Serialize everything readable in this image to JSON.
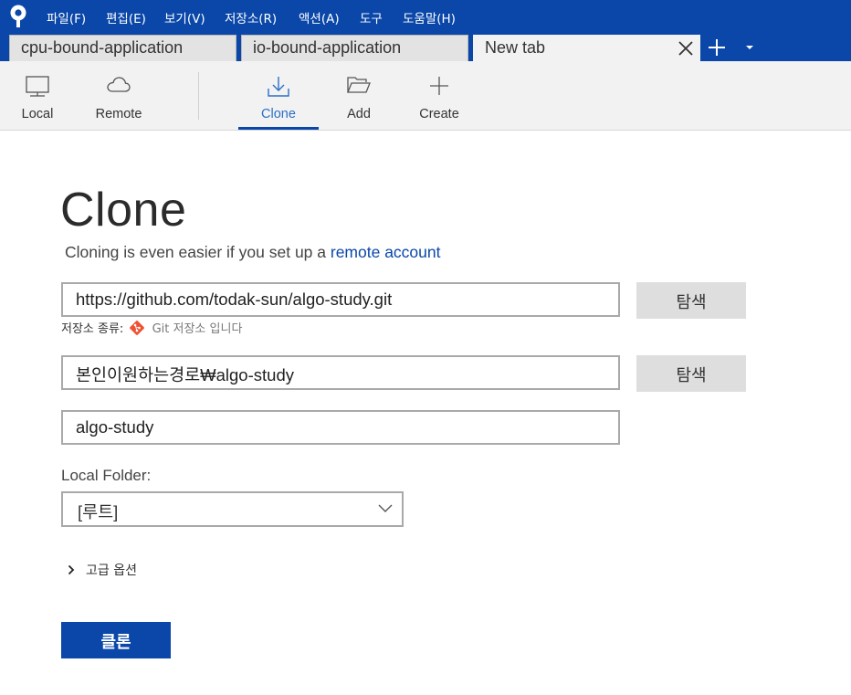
{
  "menu": [
    "파일(F)",
    "편집(E)",
    "보기(V)",
    "저장소(R)",
    "액션(A)",
    "도구",
    "도움말(H)"
  ],
  "tabs": [
    {
      "label": "cpu-bound-application",
      "active": false
    },
    {
      "label": "io-bound-application",
      "active": false
    },
    {
      "label": "New tab",
      "active": true
    }
  ],
  "toolbar": {
    "local": "Local",
    "remote": "Remote",
    "clone": "Clone",
    "add": "Add",
    "create": "Create"
  },
  "clone": {
    "title": "Clone",
    "subtitle_prefix": "Cloning is even easier if you set up a",
    "subtitle_link": "remote account",
    "source_url": "https://github.com/todak-sun/algo-study.git",
    "browse_label": "탐색",
    "repo_type_prefix": "저장소 종류:",
    "repo_type_value": "Git 저장소 입니다",
    "destination_path": "본인이원하는경로₩algo-study",
    "name": "algo-study",
    "local_folder_label": "Local Folder:",
    "local_folder_value": "[루트]",
    "advanced_options": "고급 옵션",
    "clone_button": "클론"
  },
  "colors": {
    "brand": "#0a47a9",
    "link": "#0a47a9",
    "active_tab_text": "#2a6fc7",
    "git": "#f05133"
  }
}
